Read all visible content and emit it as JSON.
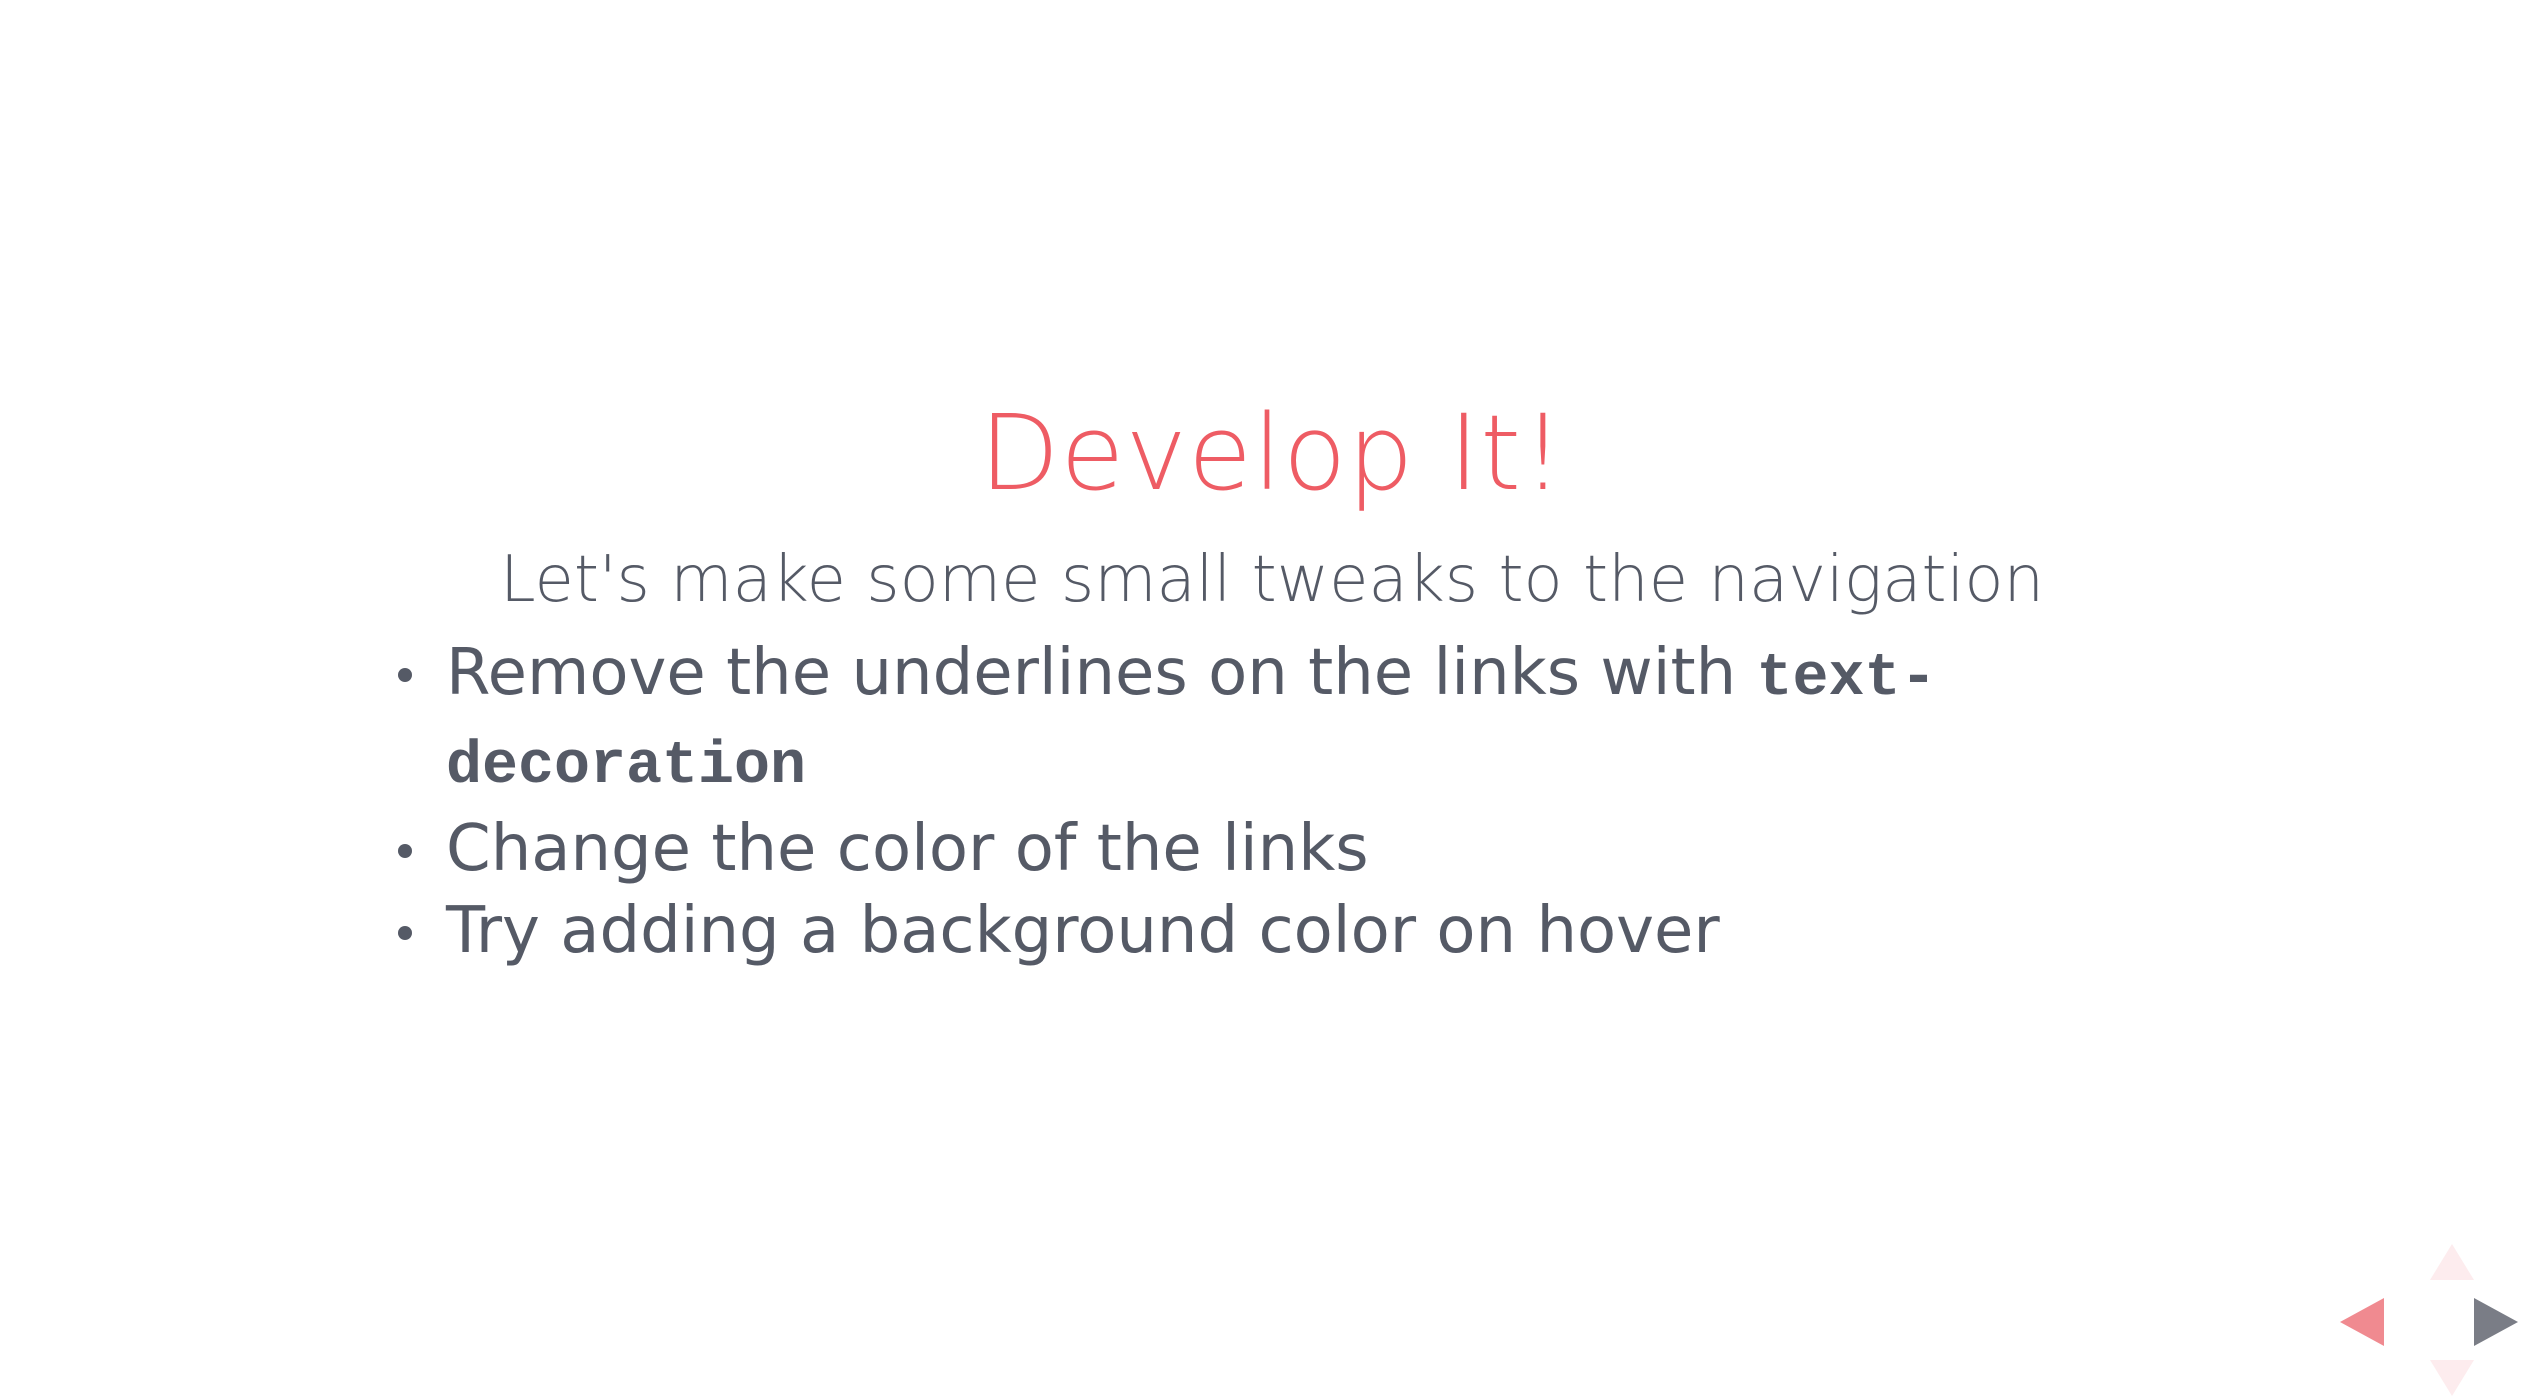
{
  "slide": {
    "title": "Develop It!",
    "subtitle": "Let's make some small tweaks to the navigation",
    "bullets": [
      {
        "text": "Remove the underlines on the links with ",
        "code": "text-decoration"
      },
      {
        "text": "Change the color of the links"
      },
      {
        "text": "Try adding a background color on hover"
      }
    ]
  },
  "controls": {
    "left_icon": "arrow-left-icon",
    "right_icon": "arrow-right-icon",
    "up_icon": "arrow-up-icon",
    "down_icon": "arrow-down-icon"
  },
  "colors": {
    "title": "#ee5c64",
    "text": "#555a66",
    "nav_prev": "#f08a90",
    "nav_next": "#7a7d86",
    "nav_disabled": "#fdecee"
  }
}
